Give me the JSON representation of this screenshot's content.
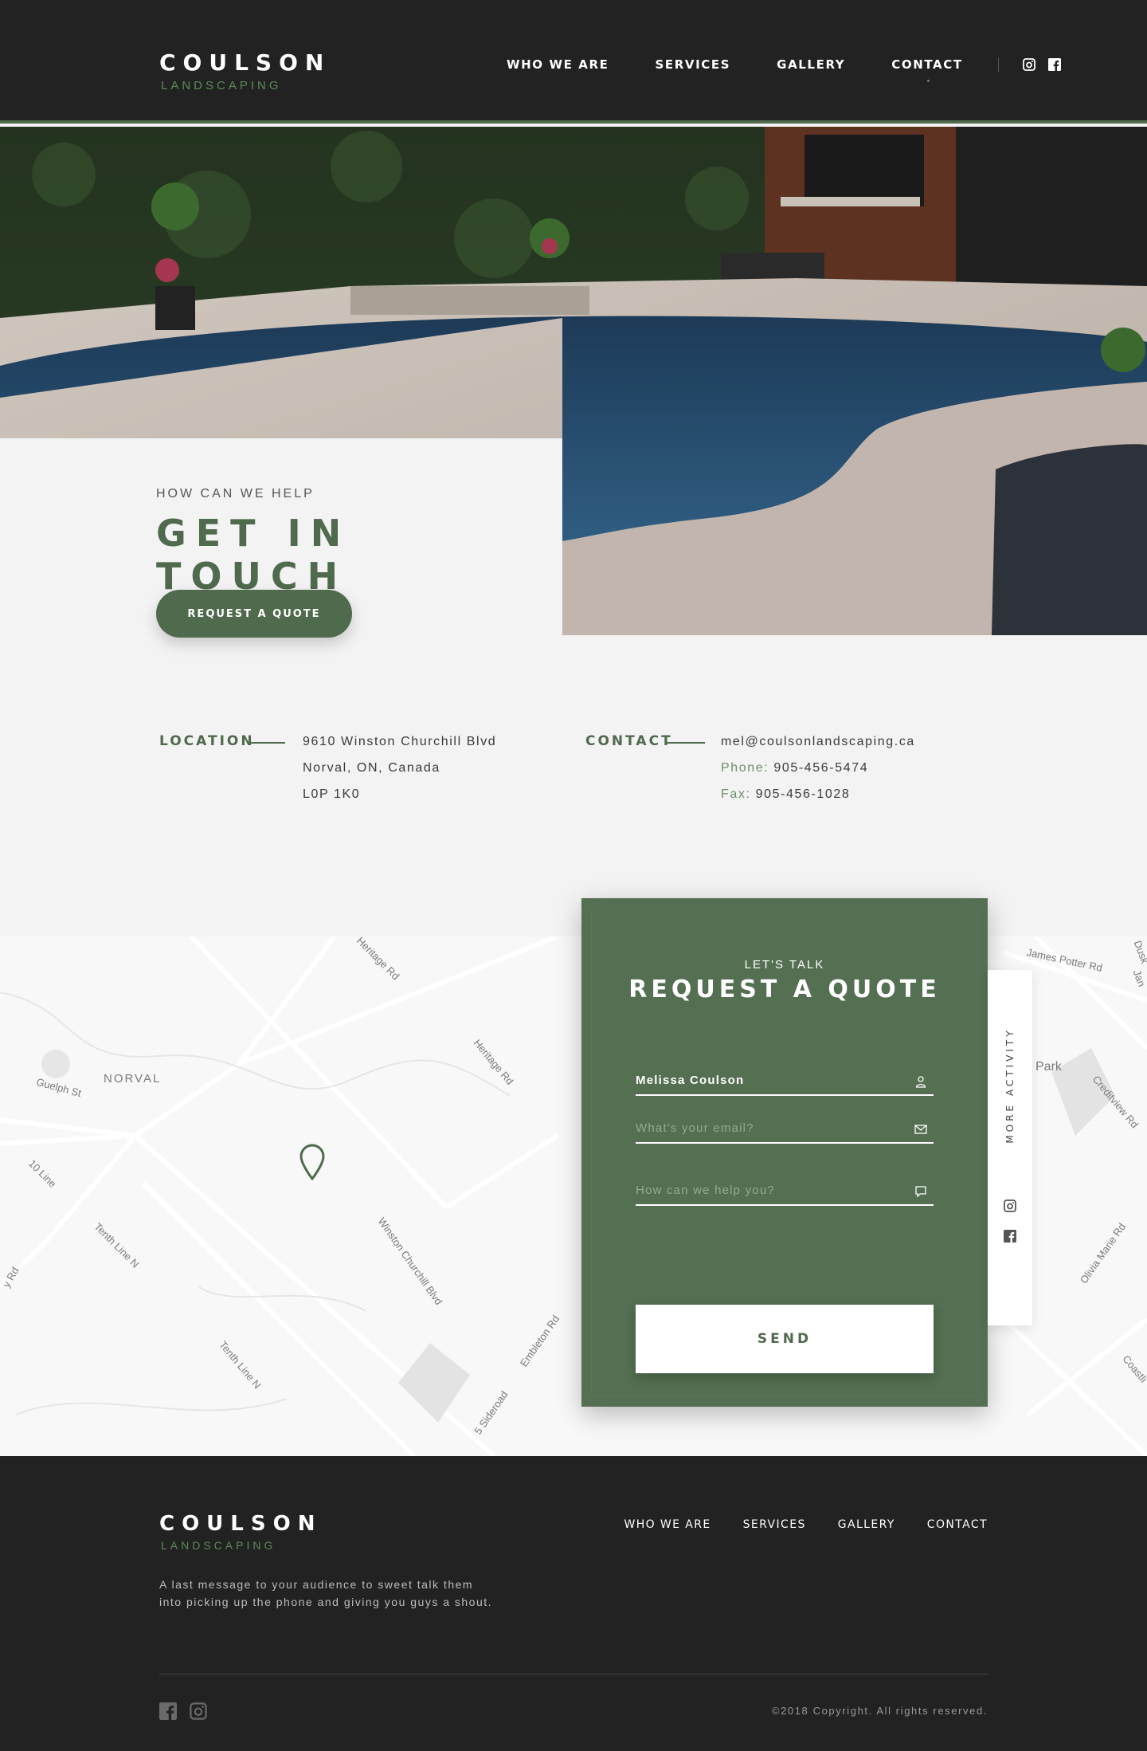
{
  "brand": {
    "name": "COULSON",
    "tagline": "LANDSCAPING"
  },
  "nav": {
    "items": [
      "WHO WE ARE",
      "SERVICES",
      "GALLERY",
      "CONTACT"
    ],
    "active": "CONTACT",
    "social_icons": [
      "instagram-icon",
      "facebook-icon"
    ]
  },
  "hero": {
    "kicker": "HOW CAN WE HELP",
    "title": "GET IN TOUCH",
    "button": "REQUEST A QUOTE"
  },
  "location": {
    "label": "LOCATION",
    "lines": [
      "9610 Winston Churchill Blvd",
      "Norval, ON, Canada",
      "L0P 1K0"
    ]
  },
  "contact": {
    "label": "CONTACT",
    "email": "mel@coulsonlandscaping.ca",
    "phone_label": "Phone:",
    "phone": "905-456-5474",
    "fax_label": "Fax:",
    "fax": "905-456-1028"
  },
  "map": {
    "labels": [
      "NORVAL",
      "Guelph St",
      "Heritage Rd",
      "Heritage Rd",
      "10 Line",
      "Tenth Line N",
      "Tenth Line N",
      "Winston Churchill Blvd",
      "Embleton Rd",
      "5 Sideroad",
      "James Potter Rd",
      "Park",
      "Creditview Rd",
      "Olivia Marie Rd",
      "Coastli",
      "Dusk",
      "Jan",
      "y Rd"
    ]
  },
  "form": {
    "kicker": "LET'S TALK",
    "title": "REQUEST A QUOTE",
    "name_value": "Melissa Coulson",
    "email_placeholder": "What's your email?",
    "message_placeholder": "How can we help you?",
    "send": "SEND"
  },
  "side_tab": {
    "label": "MORE ACTIVITY"
  },
  "footer": {
    "text": "A last message to your audience to sweet talk them into picking up the phone and giving you guys a shout.",
    "nav": [
      "WHO WE ARE",
      "SERVICES",
      "GALLERY",
      "CONTACT"
    ],
    "copyright": "©2018 Copyright. All rights reserved."
  },
  "colors": {
    "accent": "#4f6a4d",
    "dark": "#222222",
    "light_bg": "#f3f3f3"
  }
}
